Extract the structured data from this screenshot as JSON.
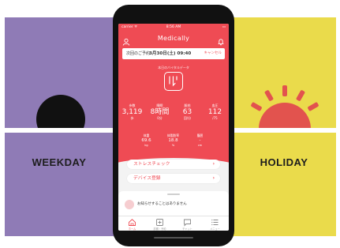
{
  "left_panel": {
    "label": "WEEKDAY",
    "color": "#8f7bb6",
    "icon": "moon-icon"
  },
  "right_panel": {
    "label": "HOLIDAY",
    "color": "#eadb4b",
    "icon": "sun-icon"
  },
  "accent": "#ef4b54",
  "status_bar": {
    "carrier": "carrier ᯤ",
    "time": "8:56 AM",
    "battery": "▭"
  },
  "app": {
    "title": "Medically"
  },
  "appointment": {
    "label": "次回のご予約:",
    "date": "3月30日(土) 09:40",
    "cancel": "キャンセル"
  },
  "vital": {
    "title": "本日のバイタルデータ"
  },
  "stats": [
    {
      "label": "歩数",
      "value": "3,119",
      "unit": "歩"
    },
    {
      "label": "睡眠",
      "value": "8時間",
      "unit": "0分"
    },
    {
      "label": "脈拍",
      "value": "63",
      "unit": "回/分"
    },
    {
      "label": "血圧",
      "value": "112",
      "unit": "/75"
    }
  ],
  "stats2": [
    {
      "label": "体重",
      "value": "69.6",
      "unit": "kg"
    },
    {
      "label": "体脂肪率",
      "value": "18.8",
      "unit": "%"
    },
    {
      "label": "腹囲",
      "value": "-",
      "unit": "cm"
    }
  ],
  "menu": [
    {
      "label": "ストレスチェック",
      "chevron": "›"
    },
    {
      "label": "デバイス登録",
      "chevron": "›"
    }
  ],
  "notification": {
    "text": "お知らせすることはありません"
  },
  "tabs": [
    {
      "label": "ホーム"
    },
    {
      "label": "診察・予約"
    },
    {
      "label": "チャット"
    },
    {
      "label": "メニュー"
    }
  ]
}
